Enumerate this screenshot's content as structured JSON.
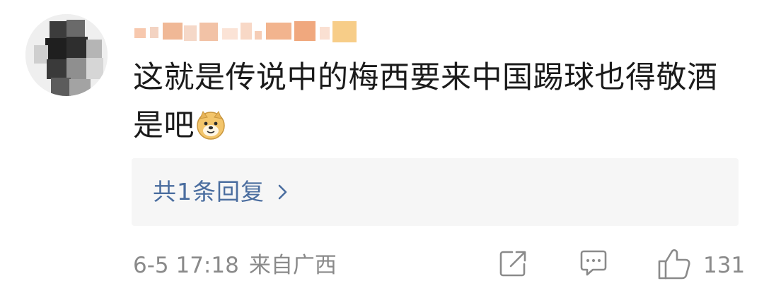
{
  "comment": {
    "text_line1": "这就是传说中的梅西要来中国踢球也得敬酒",
    "text_line2": "是吧",
    "emoji": "doge-emoji"
  },
  "replies": {
    "label": "共1条回复"
  },
  "meta": {
    "timestamp": "6-5 17:18",
    "source": "来自广西"
  },
  "actions": {
    "share_icon": "share-icon",
    "comment_icon": "comment-icon",
    "like_icon": "like-icon",
    "like_count": "131"
  },
  "colors": {
    "text": "#1b1b1b",
    "link": "#4a6d9f",
    "muted": "#8a8a8a",
    "reply_bg": "#f6f6f6"
  }
}
